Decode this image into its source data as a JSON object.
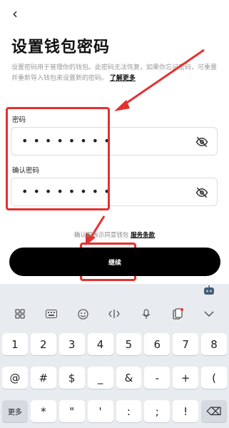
{
  "header": {
    "back_icon": "‹"
  },
  "title": "设置钱包密码",
  "description": {
    "text": "设置密码用于管理你的钱包。此密码无法恢复，如果你忘记密码，可重置并重新导入钱包来设置新的密码。",
    "more_link": "了解更多"
  },
  "password": {
    "label": "密码",
    "value": "••••••••"
  },
  "confirm": {
    "label": "确认密码",
    "value": "••••••••"
  },
  "terms": {
    "prefix": "确认即表示同意钱包",
    "link": "服务条款"
  },
  "continue_label": "继续",
  "annotation_color": "#e4312f",
  "keyboard": {
    "toolbar": [
      "grid-icon",
      "keyboard-icon",
      "emoji-icon",
      "cursor-icon",
      "mic-icon",
      "clipboard-icon",
      "chevron-down-icon"
    ],
    "row1": [
      "1",
      "2",
      "3",
      "4",
      "5",
      "6",
      "7",
      "8"
    ],
    "row2": [
      "@",
      "#",
      "$",
      "_",
      "&",
      "-",
      "+",
      "("
    ],
    "row3": [
      "更多",
      "*",
      "\"",
      "'",
      ":",
      ";",
      "!",
      "⌫"
    ]
  }
}
